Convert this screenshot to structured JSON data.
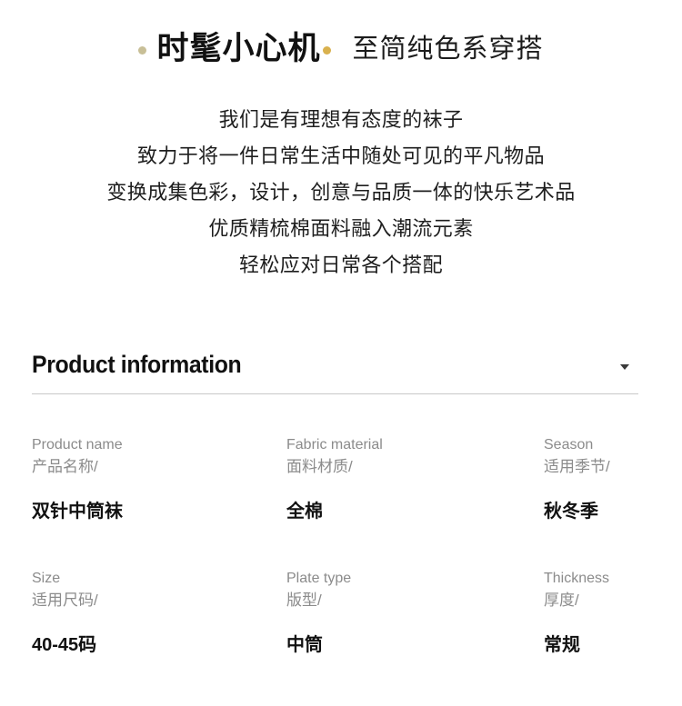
{
  "hero": {
    "dot_left_icon": "bullet-dot-icon",
    "dot_left_color": "#c8bf97",
    "title": "时髦小心机",
    "dot_right_icon": "bullet-dot-icon",
    "dot_right_color": "#d9b14e",
    "subtitle": "至简纯色系穿搭"
  },
  "description": {
    "lines": [
      "我们是有理想有态度的袜子",
      "致力于将一件日常生活中随处可见的平凡物品",
      "变换成集色彩，设计，创意与品质一体的快乐艺术品",
      "优质精梳棉面料融入潮流元素",
      "轻松应对日常各个搭配"
    ]
  },
  "product_information": {
    "title": "Product information",
    "caret_icon": "chevron-down-icon",
    "specs": [
      {
        "label_en": "Product name",
        "label_cn": "产品名称/",
        "value": "双针中筒袜"
      },
      {
        "label_en": "Fabric material",
        "label_cn": "面料材质/",
        "value": "全棉"
      },
      {
        "label_en": "Season",
        "label_cn": "适用季节/",
        "value": "秋冬季"
      },
      {
        "label_en": "Size",
        "label_cn": "适用尺码/",
        "value": "40-45码"
      },
      {
        "label_en": "Plate type",
        "label_cn": "版型/",
        "value": "中筒"
      },
      {
        "label_en": "Thickness",
        "label_cn": "厚度/",
        "value": "常规"
      }
    ]
  }
}
